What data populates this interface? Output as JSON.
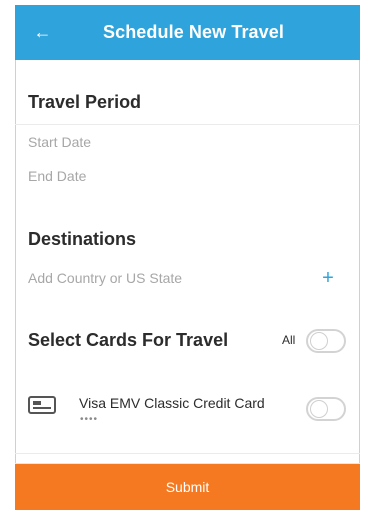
{
  "header": {
    "back_icon": "arrow-left-icon",
    "title": "Schedule New Travel"
  },
  "travel_period": {
    "title": "Travel Period",
    "start_placeholder": "Start Date",
    "end_placeholder": "End Date"
  },
  "destinations": {
    "title": "Destinations",
    "placeholder": "Add Country or US State",
    "add_icon": "plus-icon"
  },
  "cards": {
    "title": "Select Cards For Travel",
    "all_label": "All",
    "all_toggle_on": false,
    "items": [
      {
        "icon": "credit-card-icon",
        "name": "Visa EMV Classic Credit Card",
        "masked_number": "••••",
        "enabled": false
      }
    ]
  },
  "footer": {
    "submit_label": "Submit"
  },
  "colors": {
    "header": "#2ea3dc",
    "accent": "#2ea3dc",
    "submit": "#f47920"
  }
}
